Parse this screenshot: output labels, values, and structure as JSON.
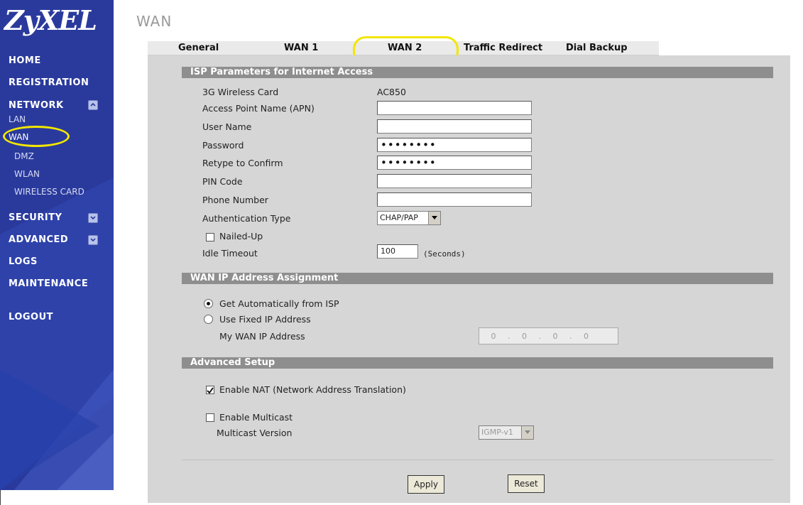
{
  "app": {
    "logo": "ZyXEL",
    "page_title": "WAN"
  },
  "sidebar": {
    "home": "HOME",
    "registration": "REGISTRATION",
    "network": "NETWORK",
    "network_items": [
      "LAN",
      "WAN",
      "DMZ",
      "WLAN",
      "WIRELESS CARD"
    ],
    "security": "SECURITY",
    "advanced": "ADVANCED",
    "logs": "LOGS",
    "maintenance": "MAINTENANCE",
    "logout": "LOGOUT",
    "selected": "WAN"
  },
  "tabs": [
    "General",
    "WAN 1",
    "WAN 2",
    "Traffic Redirect",
    "Dial Backup"
  ],
  "active_tab": "WAN 2",
  "isp": {
    "header": "ISP Parameters for Internet Access",
    "card_label": "3G Wireless Card",
    "card_value": "AC850",
    "apn_label": "Access Point Name (APN)",
    "apn_value": "",
    "user_label": "User Name",
    "user_value": "",
    "password_label": "Password",
    "password_value": "••••••••",
    "retype_label": "Retype to Confirm",
    "retype_value": "••••••••",
    "pin_label": "PIN Code",
    "pin_value": "",
    "phone_label": "Phone Number",
    "phone_value": "",
    "auth_label": "Authentication Type",
    "auth_value": "CHAP/PAP",
    "nailed_label": "Nailed-Up",
    "nailed_checked": false,
    "idle_label": "Idle Timeout",
    "idle_value": "100",
    "idle_unit": "(Seconds)"
  },
  "wanip": {
    "header": "WAN IP Address Assignment",
    "auto_label": "Get Automatically from ISP",
    "fixed_label": "Use Fixed IP Address",
    "selected": "auto",
    "my_ip_label": "My WAN IP Address",
    "ip": [
      "0",
      "0",
      "0",
      "0"
    ]
  },
  "advanced": {
    "header": "Advanced Setup",
    "nat_label": "Enable NAT (Network Address Translation)",
    "nat_checked": true,
    "multicast_label": "Enable Multicast",
    "multicast_checked": false,
    "multicast_version_label": "Multicast Version",
    "multicast_version_value": "IGMP-v1"
  },
  "buttons": {
    "apply": "Apply",
    "reset": "Reset"
  },
  "colors": {
    "sidebar_bg": "#2a3a9c",
    "highlight": "#f2e600",
    "panel_bg": "#d6d6d6",
    "section_header": "#8e8e8e"
  }
}
